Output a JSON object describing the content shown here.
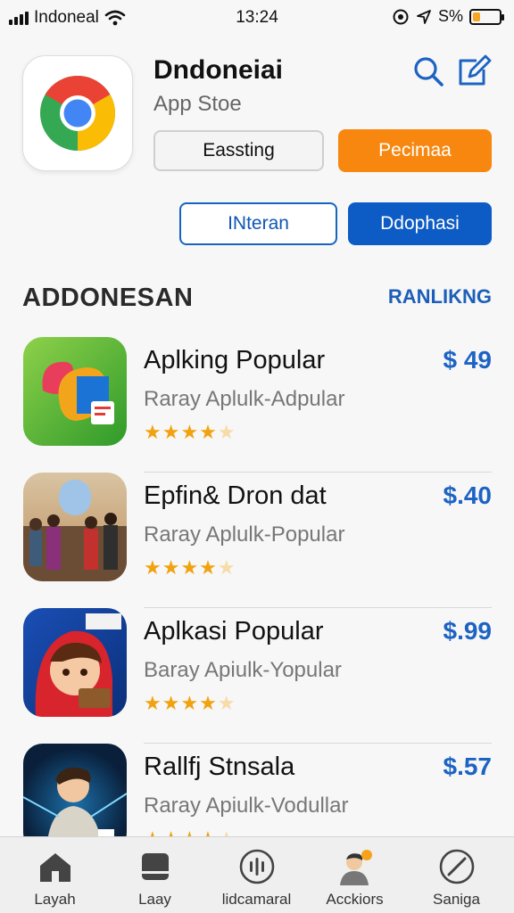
{
  "status_bar": {
    "carrier": "Indoneal",
    "time": "13:24",
    "right_text": "S%",
    "battery_level": 0.3
  },
  "app": {
    "title": "Dndoneiai",
    "subtitle": "App Stoe",
    "icon": "chrome-icon",
    "buttons": {
      "gray": "Eassting",
      "orange": "Pecimaa",
      "outline": "INteran",
      "blue": "Ddophasi"
    }
  },
  "section": {
    "title": "ADDONESAN",
    "link": "RANLIKNG"
  },
  "items": [
    {
      "name": "Aplking Popular",
      "subtitle": "Raray Aplulk-Adpular",
      "price": "$ 49",
      "rating": 4.5
    },
    {
      "name": "Epfin& Dron dat",
      "subtitle": "Raray Aplulk-Popular",
      "price": "$.40",
      "rating": 4.5
    },
    {
      "name": "Aplkasi Popular",
      "subtitle": "Baray Apiulk-Yopular",
      "price": "$.99",
      "rating": 4.5
    },
    {
      "name": "Rallfj Stnsala",
      "subtitle": "Raray Apiulk-Vodullar",
      "price": "$.57",
      "rating": 4.5
    }
  ],
  "tabs": [
    {
      "label": "Layah",
      "icon": "home-icon"
    },
    {
      "label": "Laay",
      "icon": "inbox-icon"
    },
    {
      "label": "lidcamaral",
      "icon": "audio-bars-icon"
    },
    {
      "label": "Acckiors",
      "icon": "avatar-icon"
    },
    {
      "label": "Saniga",
      "icon": "compass-icon"
    }
  ],
  "colors": {
    "accent_blue": "#1d63c4",
    "accent_orange": "#f7870f",
    "star": "#f2a20f"
  }
}
